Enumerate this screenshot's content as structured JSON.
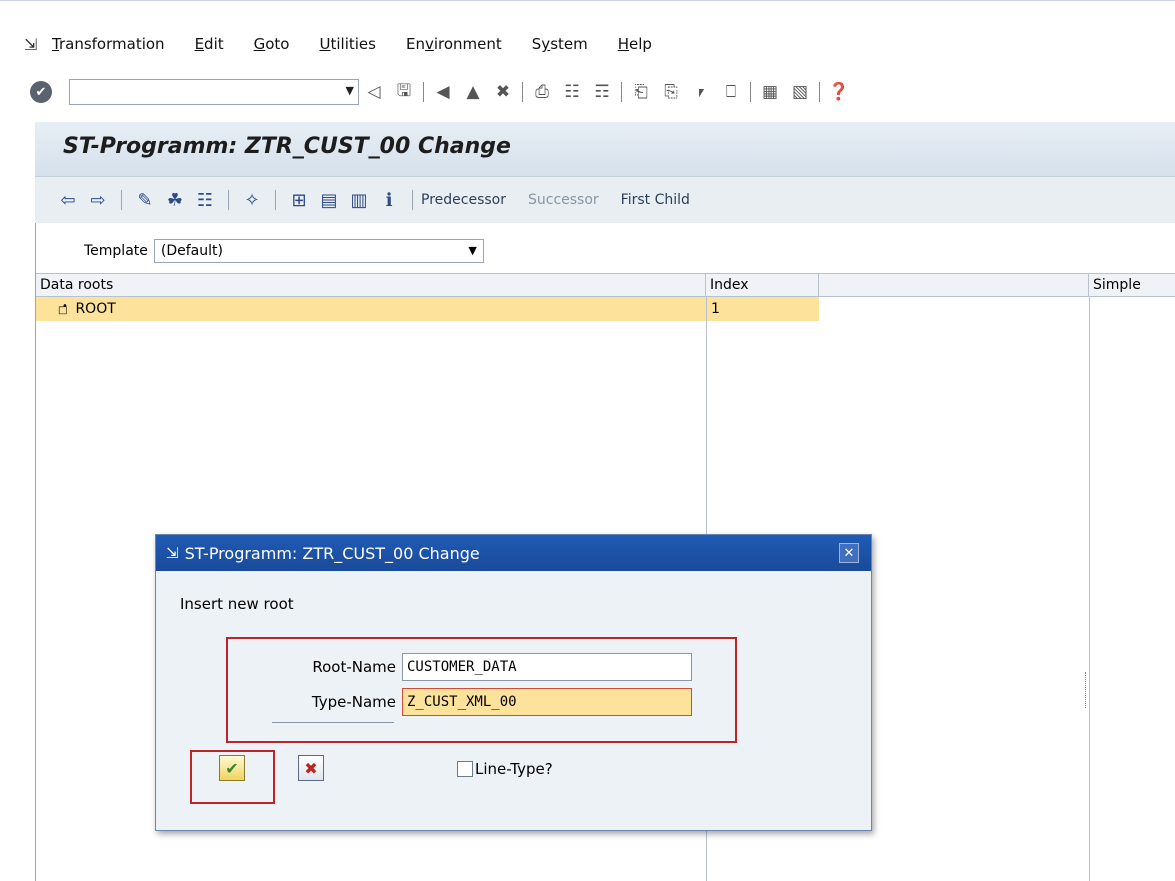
{
  "menubar": {
    "items": [
      {
        "label": "Transformation",
        "underline": "T",
        "rest": "ransformation"
      },
      {
        "label": "Edit",
        "underline": "E",
        "rest": "dit"
      },
      {
        "label": "Goto",
        "underline": "G",
        "rest": "oto"
      },
      {
        "label": "Utilities",
        "underline": "U",
        "rest": "tilities"
      },
      {
        "label": "Environment",
        "pre": "En",
        "underline": "v",
        "rest": "ironment"
      },
      {
        "label": "System",
        "pre": "S",
        "underline": "y",
        "rest": "stem"
      },
      {
        "label": "Help",
        "underline": "H",
        "rest": "elp"
      }
    ]
  },
  "command_field": {
    "value": ""
  },
  "title": "ST-Programm: ZTR_CUST_00 Change",
  "app_toolbar": {
    "predecessor": "Predecessor",
    "successor": "Successor",
    "first_child": "First Child"
  },
  "template": {
    "label": "Template",
    "value": "(Default)"
  },
  "grid": {
    "headers": [
      "Data roots",
      "Index",
      "",
      "Simple"
    ],
    "rows": [
      {
        "name": "ROOT",
        "index": "1"
      }
    ]
  },
  "dialog": {
    "title": "ST-Programm: ZTR_CUST_00 Change",
    "heading": "Insert new root",
    "root_name_label": "Root-Name",
    "root_name_value": "CUSTOMER_DATA",
    "type_name_label": "Type-Name",
    "type_name_value": "Z_CUST_XML_00",
    "line_type_label": "Line-Type?"
  },
  "colors": {
    "highlight": "#fde29c",
    "dialog_title": "#1f5bb5",
    "annotation_red": "#b9252b"
  }
}
